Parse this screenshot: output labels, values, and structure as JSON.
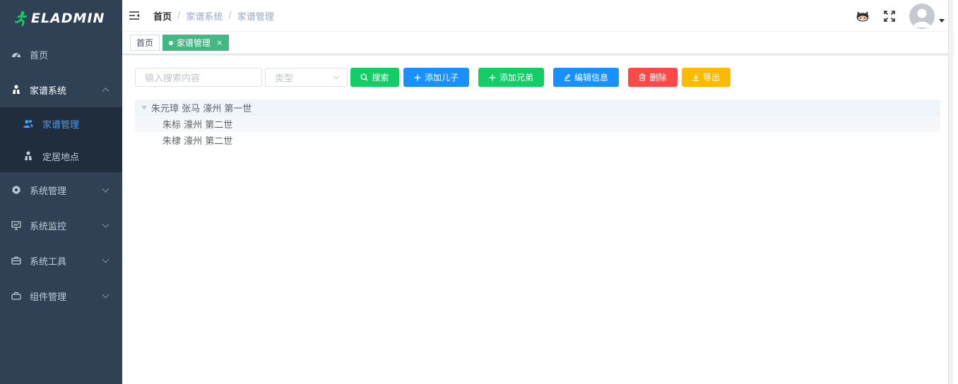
{
  "app": {
    "logo_text": "ELADMIN",
    "logo_color": "#13ce66"
  },
  "sidebar": {
    "items": [
      {
        "label": "首页",
        "icon": "dashboard-icon"
      },
      {
        "label": "家谱系统",
        "icon": "family-icon",
        "expanded": true,
        "children": [
          {
            "label": "家谱管理",
            "icon": "people-icon",
            "active": true
          },
          {
            "label": "定居地点",
            "icon": "family-icon"
          }
        ]
      },
      {
        "label": "系统管理",
        "icon": "gear-icon"
      },
      {
        "label": "系统监控",
        "icon": "monitor-icon"
      },
      {
        "label": "系统工具",
        "icon": "toolbox-icon"
      },
      {
        "label": "组件管理",
        "icon": "component-icon"
      }
    ]
  },
  "navbar": {
    "breadcrumb": [
      "首页",
      "家谱系统",
      "家谱管理"
    ]
  },
  "tags": [
    {
      "label": "首页",
      "active": false
    },
    {
      "label": "家谱管理",
      "active": true,
      "close": "×"
    }
  ],
  "toolbar": {
    "search_placeholder": "输入搜索内容",
    "type_placeholder": "类型",
    "search_label": "搜索",
    "add_child_label": "添加儿子",
    "add_sibling_label": "添加兄弟",
    "edit_label": "编辑信息",
    "delete_label": "删除",
    "export_label": "导出"
  },
  "tree": {
    "root": "朱元璋 张马 濠州 第一世",
    "children": [
      "朱标 濠州 第二世",
      "朱棣 濠州 第二世"
    ]
  },
  "colors": {
    "sidebar_bg": "#304156",
    "submenu_bg": "#1f2d3d",
    "active_menu": "#409eff",
    "tag_active": "#42b983",
    "success": "#13ce66",
    "primary": "#1890ff",
    "danger": "#ff4949",
    "warning": "#ffba00"
  }
}
